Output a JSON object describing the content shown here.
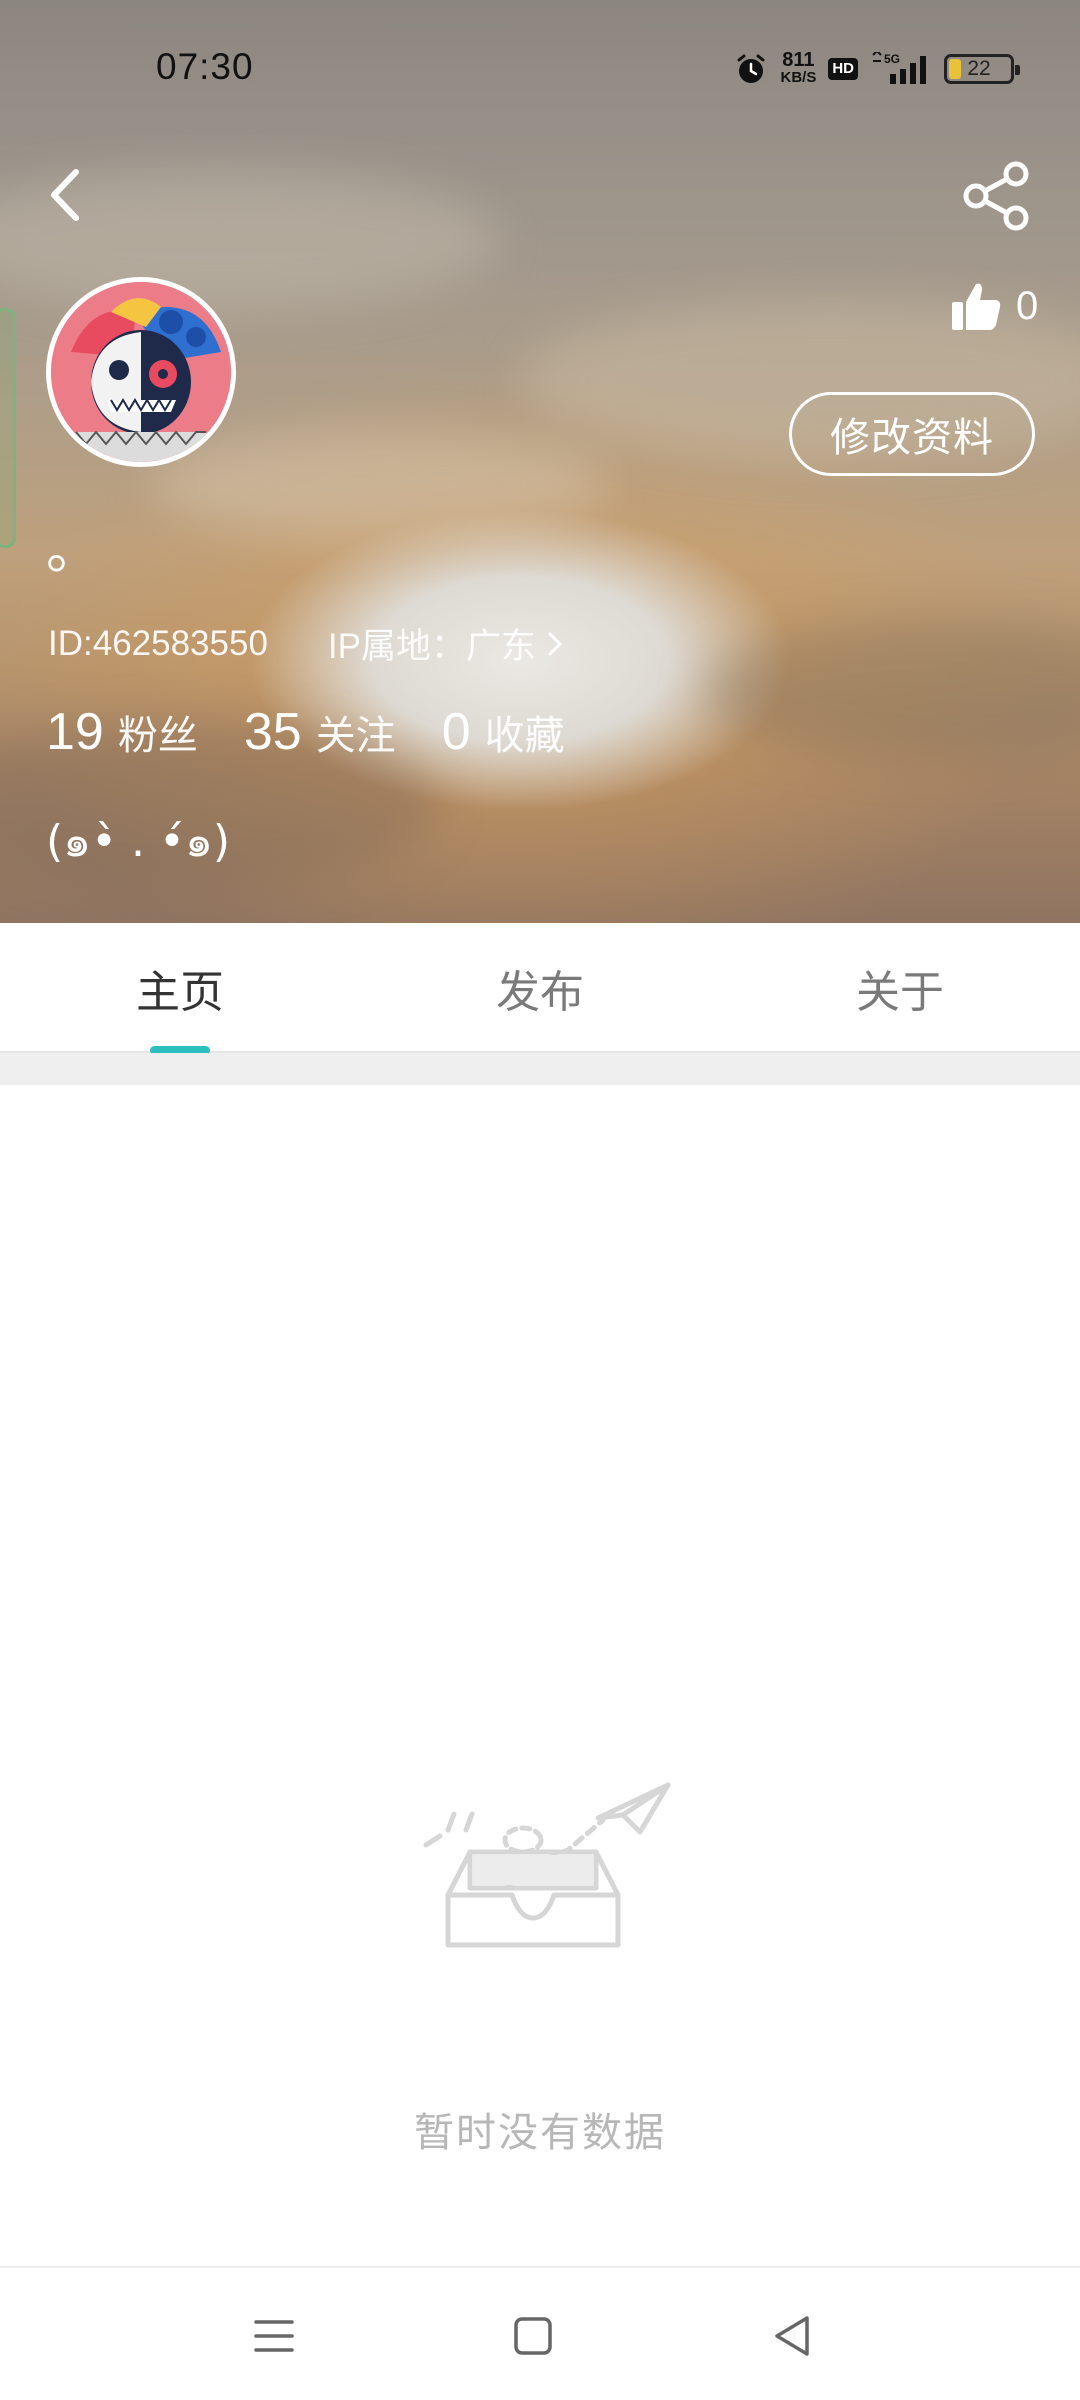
{
  "status_bar": {
    "time": "07:30",
    "net_speed_value": "811",
    "net_speed_unit": "KB/S",
    "hd_label": "HD",
    "network": "5G",
    "battery": "22",
    "icons": [
      "alarm-icon",
      "signal-icon",
      "battery-icon"
    ]
  },
  "header": {
    "back_icon": "chevron-left-icon",
    "share_icon": "share-icon",
    "like_icon": "thumbs-up-icon",
    "like_count": "0",
    "edit_button": "修改资料"
  },
  "profile": {
    "nickname": "。",
    "id_text": "ID:462583550",
    "ip_text": "IP属地：广东",
    "stats": [
      {
        "value": "19",
        "label": "粉丝"
      },
      {
        "value": "35",
        "label": "关注"
      },
      {
        "value": "0",
        "label": "收藏"
      }
    ],
    "bio": "(๑•̀ . •́๑)"
  },
  "tabs": [
    {
      "label": "主页",
      "active": true
    },
    {
      "label": "发布",
      "active": false
    },
    {
      "label": "关于",
      "active": false
    }
  ],
  "empty_state": {
    "icon": "empty-inbox-icon",
    "text": "暂时没有数据"
  },
  "bottom_nav": {
    "icons": [
      "menu-icon",
      "home-square-icon",
      "back-triangle-icon"
    ]
  },
  "colors": {
    "accent": "#2bbfbf",
    "tab_inactive": "#7a7a7a",
    "empty_text": "#b7b7b7"
  }
}
